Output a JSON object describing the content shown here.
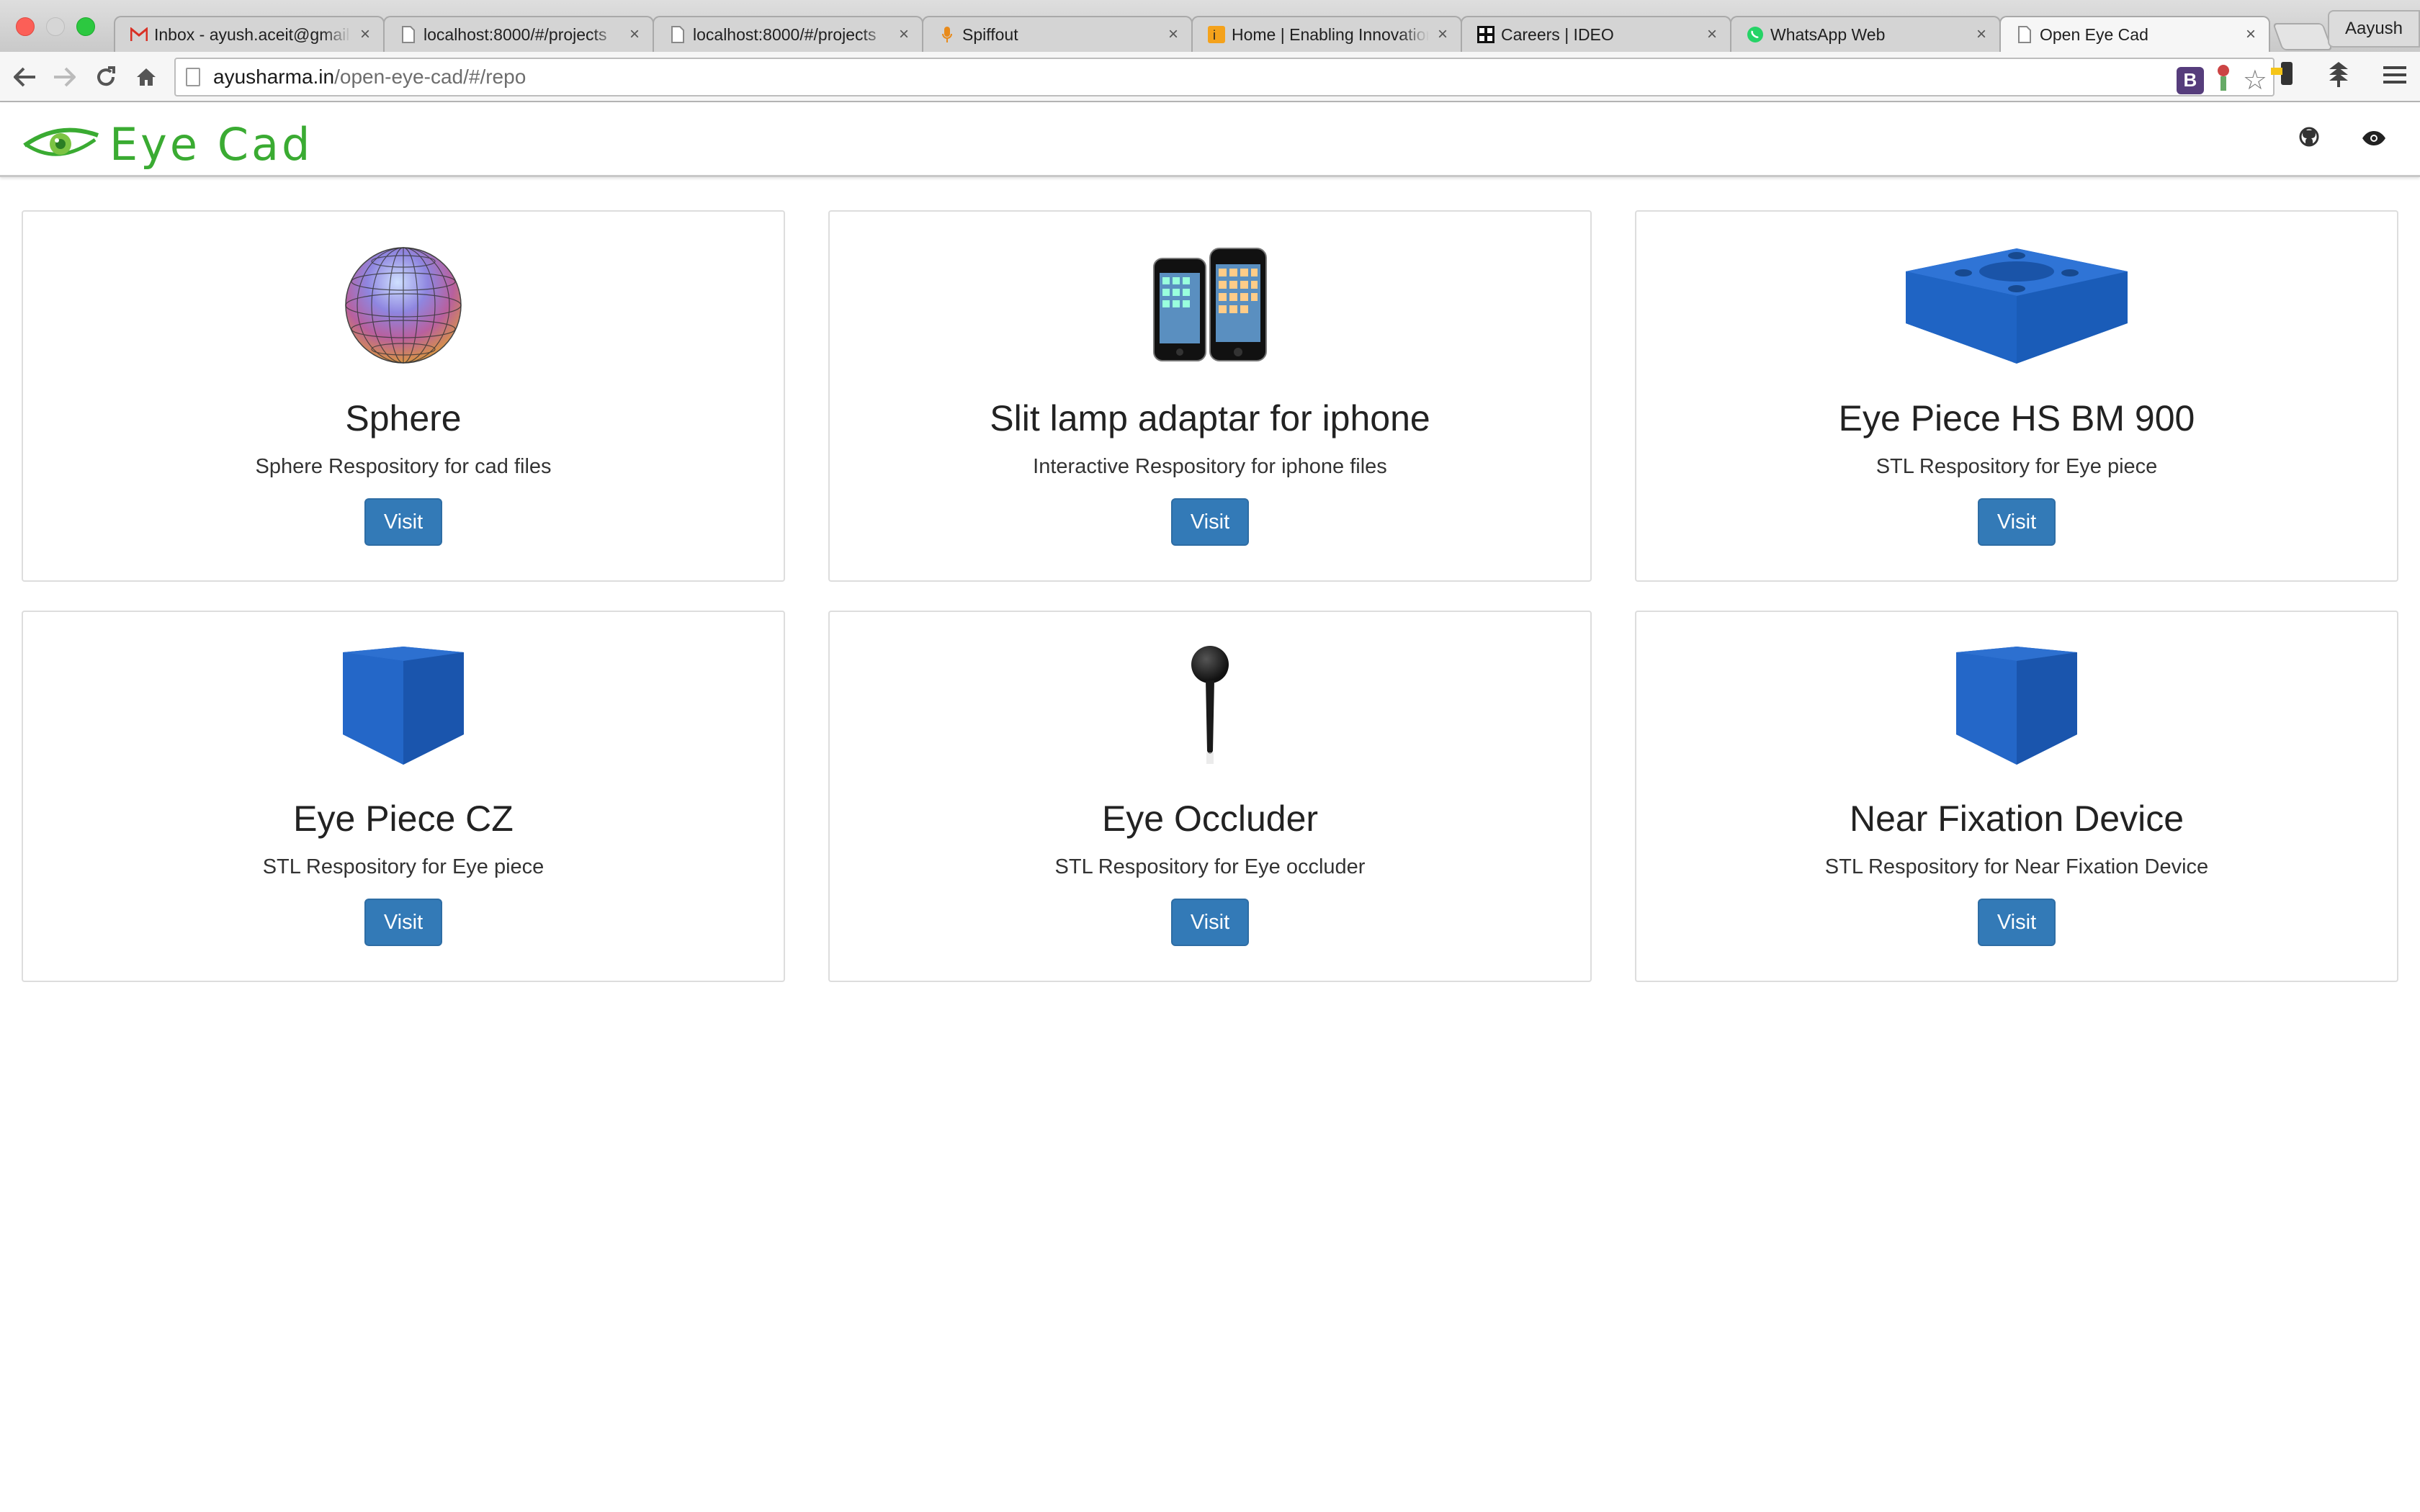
{
  "browser": {
    "tabs": [
      {
        "title": "Inbox - ayush.aceit@gmail.com",
        "icon": "gmail-icon",
        "active": false
      },
      {
        "title": "localhost:8000/#/projects",
        "icon": "page-icon",
        "active": false
      },
      {
        "title": "localhost:8000/#/projects",
        "icon": "page-icon",
        "active": false
      },
      {
        "title": "Spiffout",
        "icon": "mic-icon",
        "active": false
      },
      {
        "title": "Home | Enabling Innovation",
        "icon": "site-icon",
        "active": false
      },
      {
        "title": "Careers | IDEO",
        "icon": "ideo-icon",
        "active": false
      },
      {
        "title": "WhatsApp Web",
        "icon": "whatsapp-icon",
        "active": false
      },
      {
        "title": "Open Eye Cad",
        "icon": "page-icon",
        "active": true
      }
    ],
    "profile_name": "Aayush",
    "url_host": "ayusharma.in",
    "url_path": "/open-eye-cad/#/repo"
  },
  "site": {
    "brand": "Eye Cad",
    "brand_color": "#3aab32",
    "nav_icons": [
      "github-icon",
      "eye-icon"
    ]
  },
  "repos": [
    {
      "title": "Sphere",
      "description": "Sphere Respository for cad files",
      "button": "Visit",
      "thumb": "sphere"
    },
    {
      "title": "Slit lamp adaptar for iphone",
      "description": "Interactive Respository for iphone files",
      "button": "Visit",
      "thumb": "iphones"
    },
    {
      "title": "Eye Piece HS BM 900",
      "description": "STL Respository for Eye piece",
      "button": "Visit",
      "thumb": "eyepiece-plate"
    },
    {
      "title": "Eye Piece CZ",
      "description": "STL Respository for Eye piece",
      "button": "Visit",
      "thumb": "blue-cube"
    },
    {
      "title": "Eye Occluder",
      "description": "STL Respository for Eye occluder",
      "button": "Visit",
      "thumb": "occluder"
    },
    {
      "title": "Near Fixation Device",
      "description": "STL Respository for Near Fixation Device",
      "button": "Visit",
      "thumb": "blue-cube"
    }
  ],
  "colors": {
    "button": "#337ab7",
    "model_blue": "#1f66c7"
  }
}
